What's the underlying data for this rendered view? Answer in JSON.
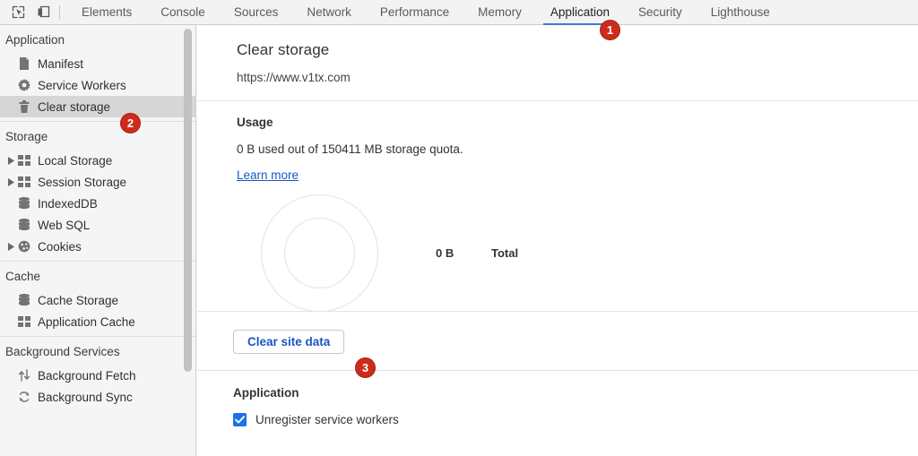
{
  "toolbar": {
    "icons": [
      {
        "name": "inspect-element-icon",
        "title": "Inspect element"
      },
      {
        "name": "device-toolbar-icon",
        "title": "Toggle device toolbar"
      }
    ],
    "tabs": [
      {
        "label": "Elements",
        "active": false
      },
      {
        "label": "Console",
        "active": false
      },
      {
        "label": "Sources",
        "active": false
      },
      {
        "label": "Network",
        "active": false
      },
      {
        "label": "Performance",
        "active": false
      },
      {
        "label": "Memory",
        "active": false
      },
      {
        "label": "Application",
        "active": true
      },
      {
        "label": "Security",
        "active": false
      },
      {
        "label": "Lighthouse",
        "active": false
      }
    ],
    "active_tab": "Application",
    "accent_color": "#3b79d6"
  },
  "sidebar": {
    "sections": [
      {
        "title": "Application",
        "items": [
          {
            "label": "Manifest",
            "icon": "manifest-file-icon",
            "twisty": false,
            "selected": false
          },
          {
            "label": "Service Workers",
            "icon": "gear-icon",
            "twisty": false,
            "selected": false
          },
          {
            "label": "Clear storage",
            "icon": "trash-icon",
            "twisty": false,
            "selected": true
          }
        ]
      },
      {
        "title": "Storage",
        "items": [
          {
            "label": "Local Storage",
            "icon": "table-icon",
            "twisty": true,
            "selected": false
          },
          {
            "label": "Session Storage",
            "icon": "table-icon",
            "twisty": true,
            "selected": false
          },
          {
            "label": "IndexedDB",
            "icon": "database-icon",
            "twisty": false,
            "selected": false
          },
          {
            "label": "Web SQL",
            "icon": "database-icon",
            "twisty": false,
            "selected": false
          },
          {
            "label": "Cookies",
            "icon": "cookie-icon",
            "twisty": true,
            "selected": false
          }
        ]
      },
      {
        "title": "Cache",
        "items": [
          {
            "label": "Cache Storage",
            "icon": "database-icon",
            "twisty": false,
            "selected": false
          },
          {
            "label": "Application Cache",
            "icon": "table-icon",
            "twisty": false,
            "selected": false
          }
        ]
      },
      {
        "title": "Background Services",
        "items": [
          {
            "label": "Background Fetch",
            "icon": "arrows-updown-icon",
            "twisty": false,
            "selected": false
          },
          {
            "label": "Background Sync",
            "icon": "sync-icon",
            "twisty": false,
            "selected": false
          }
        ]
      }
    ]
  },
  "main": {
    "title": "Clear storage",
    "origin": "https://www.v1tx.com",
    "usage": {
      "heading": "Usage",
      "text": "0 B used out of 150411 MB storage quota.",
      "learn_more": "Learn more"
    },
    "clear_button": "Clear site data",
    "application": {
      "heading": "Application",
      "checkbox_label": "Unregister service workers",
      "checkbox_checked": true,
      "checkbox_color": "#1a73e8"
    }
  },
  "chart_data": {
    "type": "pie",
    "title": "Usage",
    "categories": [
      "Total"
    ],
    "values": [
      0
    ],
    "labels": [
      "0 B"
    ],
    "legend": [
      {
        "value": "0 B",
        "name": "Total"
      }
    ],
    "legend_position": "right",
    "empty": true,
    "ring_color": "#e8e8e8",
    "unit": "B"
  },
  "badges": [
    {
      "id": "badge-1",
      "label": "1",
      "target": "tab-application"
    },
    {
      "id": "badge-2",
      "label": "2",
      "target": "sidebar-item-clear-storage"
    },
    {
      "id": "badge-3",
      "label": "3",
      "target": "clear-site-data-button"
    }
  ],
  "badge_color": "#cd2b1c"
}
